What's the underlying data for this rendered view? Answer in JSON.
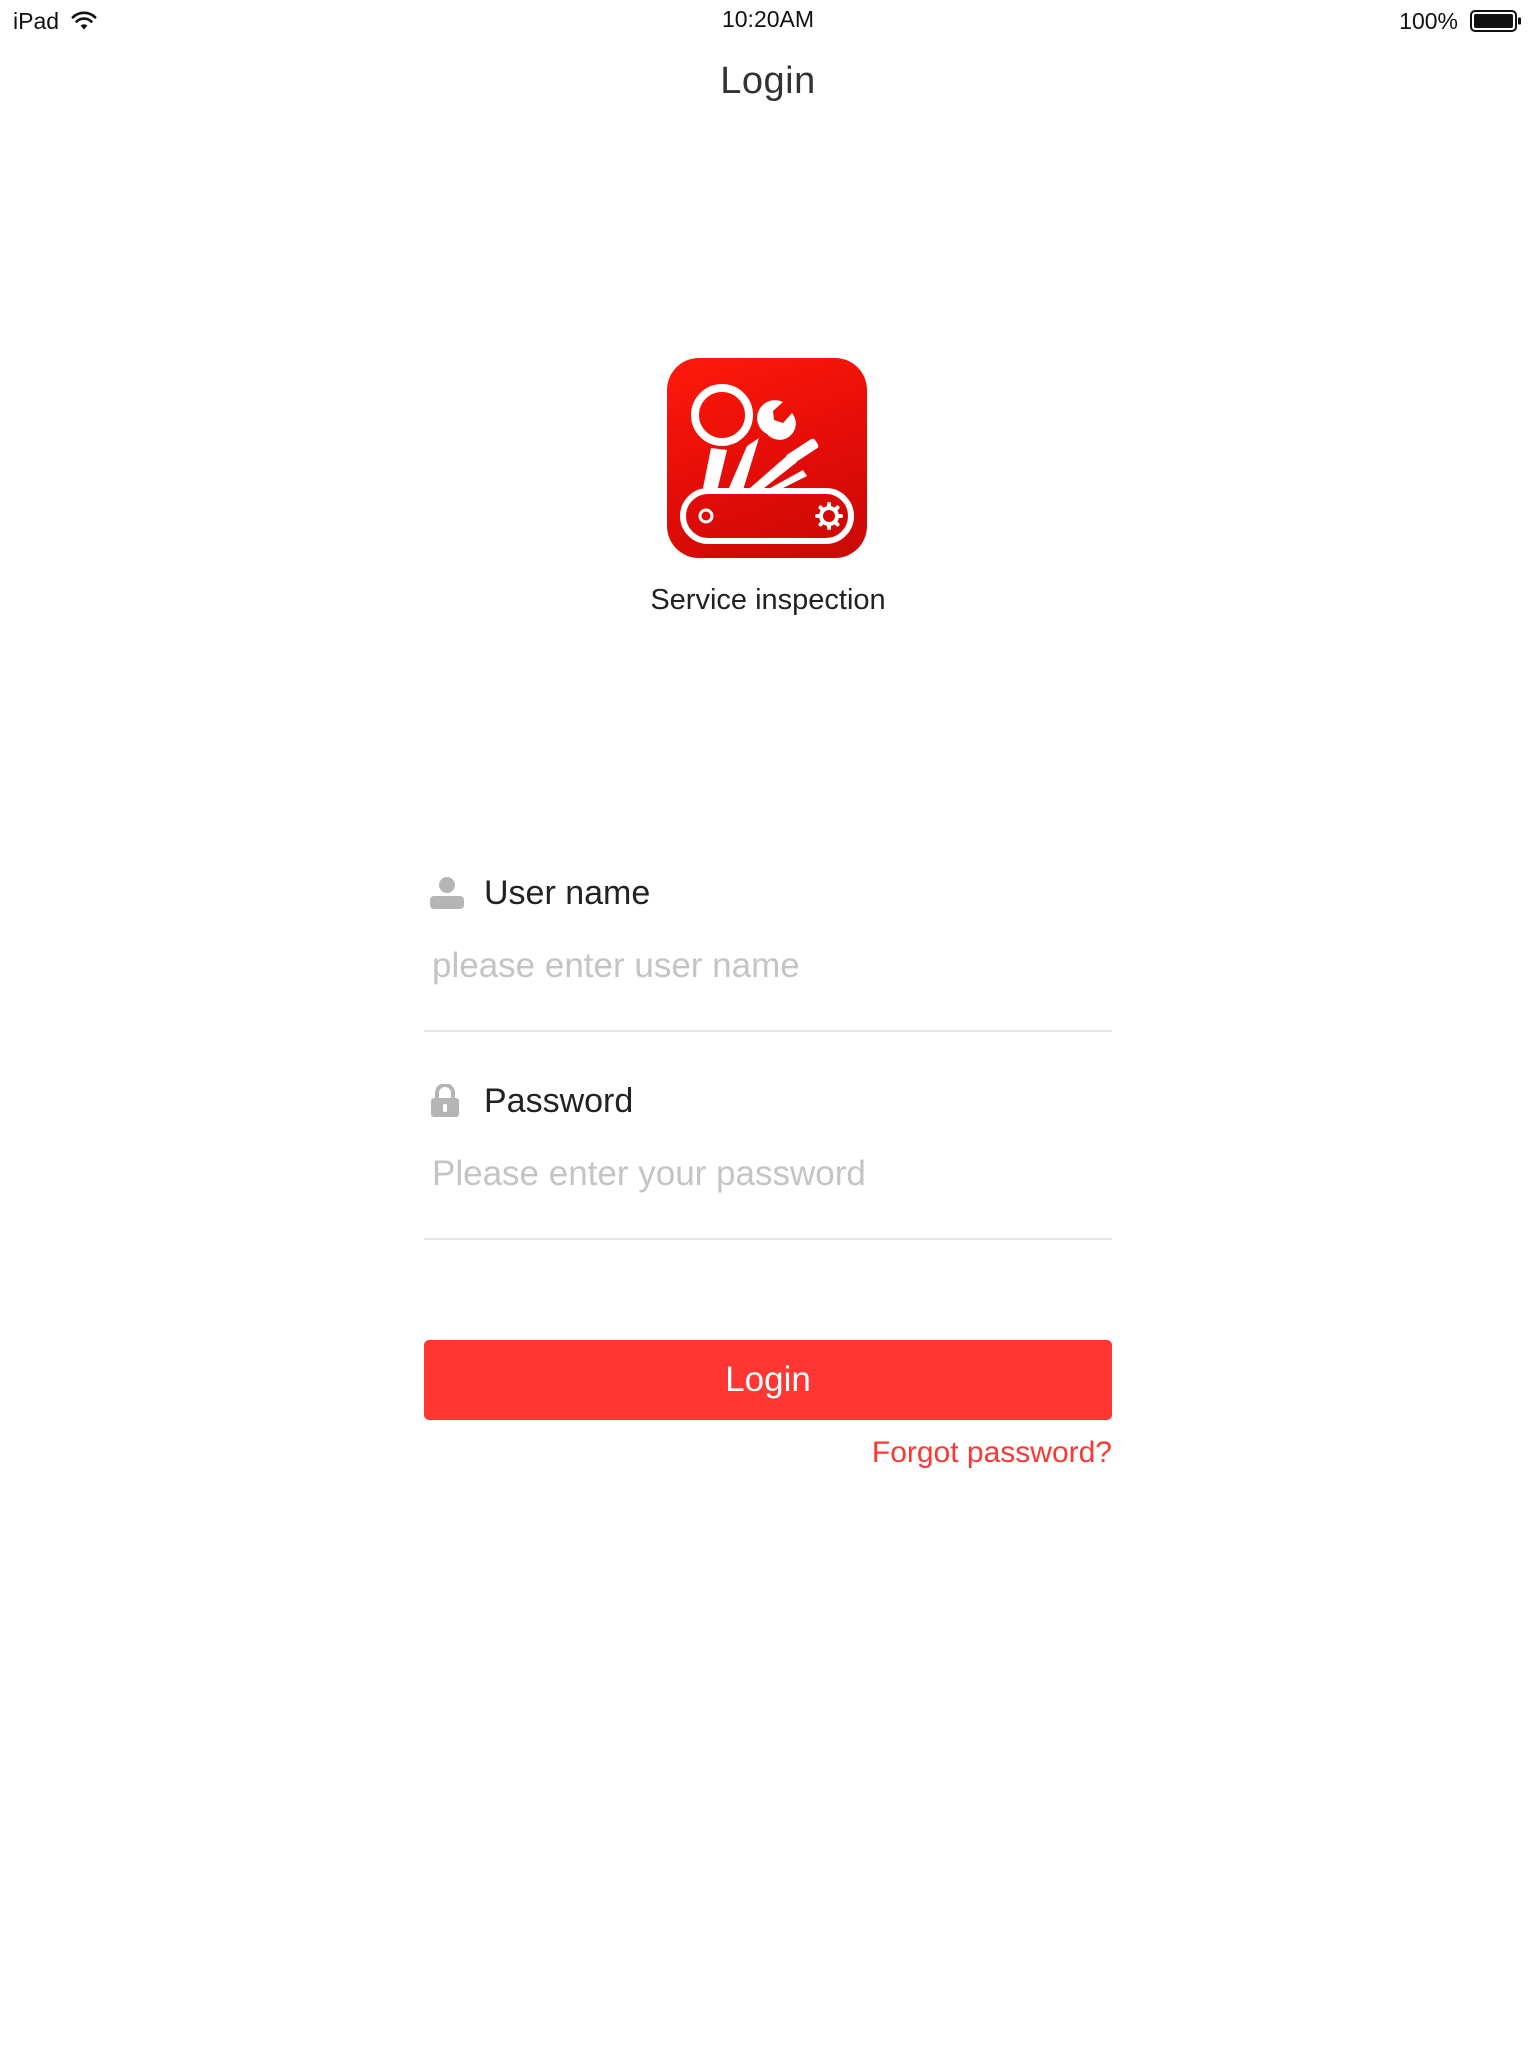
{
  "status_bar": {
    "device": "iPad",
    "time": "10:20AM",
    "battery_percent": "100%",
    "icons": [
      "wifi-icon",
      "battery-icon"
    ]
  },
  "nav": {
    "title": "Login"
  },
  "app": {
    "name": "Service inspection",
    "logo_icon": "swiss-army-knife-icon",
    "brand_color": "#e60d08"
  },
  "form": {
    "username": {
      "label": "User name",
      "icon": "user-icon",
      "value": "",
      "placeholder": "please enter user name"
    },
    "password": {
      "label": "Password",
      "icon": "lock-icon",
      "value": "",
      "placeholder": "Please enter your password"
    }
  },
  "actions": {
    "login_label": "Login",
    "forgot_label": "Forgot password?"
  },
  "colors": {
    "accent": "#ff3632",
    "placeholder": "#c4c4c4",
    "divider": "#e6e6e6",
    "icon_gray": "#b5b5b5"
  }
}
